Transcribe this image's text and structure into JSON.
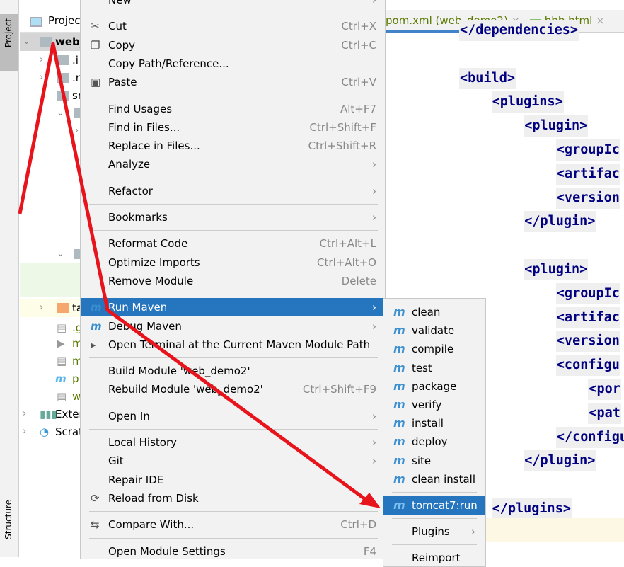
{
  "sidebar": {
    "project_tab": "Project",
    "structure_tab": "Structure"
  },
  "tree": {
    "header": "Projec",
    "root": "web_",
    "items": [
      ".i",
      ".r",
      "sr",
      "m",
      "ta",
      ".g",
      "m",
      "m",
      "p",
      "w"
    ],
    "external": "Exter",
    "scratches": "Scrat"
  },
  "editor": {
    "tabs": [
      {
        "label": "pom.xml (web_demo2)",
        "active": true
      },
      {
        "label": "bbb.html",
        "active": false
      }
    ],
    "lines": [
      "</dependencies>",
      "",
      "<build>",
      "    <plugins>",
      "        <plugin>",
      "            <groupIc",
      "            <artifac",
      "            <version",
      "        </plugin>",
      "",
      "        <plugin>",
      "            <groupIc",
      "            <artifac",
      "            <version",
      "            <configu",
      "                <por",
      "                <pat",
      "            </configu",
      "        </plugin>",
      "",
      "    </plugins>"
    ]
  },
  "menu": {
    "items": [
      {
        "label": "New",
        "arrow": true
      },
      {
        "sep": true
      },
      {
        "label": "Cut",
        "shortcut": "Ctrl+X",
        "icon": "scissors-icon"
      },
      {
        "label": "Copy",
        "shortcut": "Ctrl+C",
        "icon": "copy-icon"
      },
      {
        "label": "Copy Path/Reference..."
      },
      {
        "label": "Paste",
        "shortcut": "Ctrl+V",
        "icon": "paste-icon"
      },
      {
        "sep": true
      },
      {
        "label": "Find Usages",
        "shortcut": "Alt+F7"
      },
      {
        "label": "Find in Files...",
        "shortcut": "Ctrl+Shift+F"
      },
      {
        "label": "Replace in Files...",
        "shortcut": "Ctrl+Shift+R"
      },
      {
        "label": "Analyze",
        "arrow": true
      },
      {
        "sep": true
      },
      {
        "label": "Refactor",
        "arrow": true
      },
      {
        "sep": true
      },
      {
        "label": "Bookmarks",
        "arrow": true
      },
      {
        "sep": true
      },
      {
        "label": "Reformat Code",
        "shortcut": "Ctrl+Alt+L"
      },
      {
        "label": "Optimize Imports",
        "shortcut": "Ctrl+Alt+O"
      },
      {
        "label": "Remove Module",
        "shortcut": "Delete"
      },
      {
        "sep": true
      },
      {
        "label": "Run Maven",
        "arrow": true,
        "selected": true,
        "icon": "maven-run-icon"
      },
      {
        "label": "Debug Maven",
        "arrow": true,
        "icon": "maven-debug-icon"
      },
      {
        "label": "Open Terminal at the Current Maven Module Path",
        "icon": "terminal-icon"
      },
      {
        "sep": true
      },
      {
        "label": "Build Module 'web_demo2'"
      },
      {
        "label": "Rebuild Module 'web_demo2'",
        "shortcut": "Ctrl+Shift+F9"
      },
      {
        "sep": true
      },
      {
        "label": "Open In",
        "arrow": true
      },
      {
        "sep": true
      },
      {
        "label": "Local History",
        "arrow": true
      },
      {
        "label": "Git",
        "arrow": true
      },
      {
        "label": "Repair IDE"
      },
      {
        "label": "Reload from Disk",
        "icon": "reload-icon"
      },
      {
        "sep": true
      },
      {
        "label": "Compare With...",
        "shortcut": "Ctrl+D",
        "icon": "compare-icon"
      },
      {
        "sep": true
      },
      {
        "label": "Open Module Settings",
        "shortcut": "F4"
      }
    ]
  },
  "submenu": {
    "items": [
      {
        "label": "clean"
      },
      {
        "label": "validate"
      },
      {
        "label": "compile"
      },
      {
        "label": "test"
      },
      {
        "label": "package"
      },
      {
        "label": "verify"
      },
      {
        "label": "install"
      },
      {
        "label": "deploy"
      },
      {
        "label": "site"
      },
      {
        "label": "clean install"
      },
      {
        "sep": true
      },
      {
        "label": "tomcat7:run",
        "selected": true
      },
      {
        "sep": true
      },
      {
        "label": "Plugins",
        "arrow": true,
        "noicon": true
      },
      {
        "sep": true
      },
      {
        "label": "Reimport",
        "noicon": true
      }
    ]
  },
  "colors": {
    "selection": "#2675bf",
    "annotation": "#e8141c",
    "tag": "#000080"
  }
}
